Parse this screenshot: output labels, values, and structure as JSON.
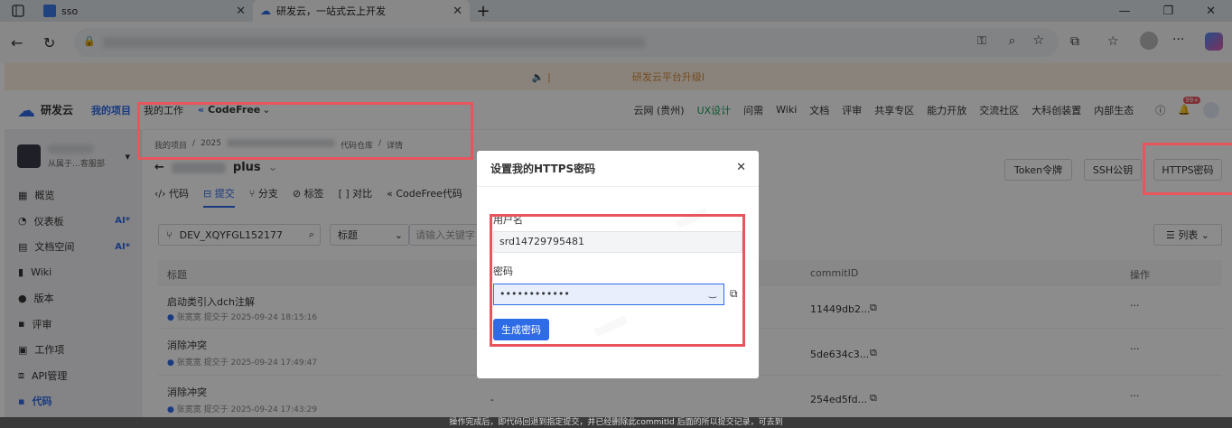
{
  "browser": {
    "tabs": [
      {
        "title": "sso"
      },
      {
        "title": "研发云，一站式云上开发"
      }
    ]
  },
  "banner": {
    "text": "研发云平台升级I"
  },
  "topnav": {
    "product": "研发云",
    "links": [
      "我的项目",
      "我的工作"
    ],
    "codefree": "CodeFree",
    "right": [
      "云网 (贵州)",
      "UX设计",
      "问需",
      "Wiki",
      "文档",
      "评审",
      "共享专区",
      "能力开放",
      "交流社区",
      "大科创装置",
      "内部生态"
    ],
    "badge": "99+"
  },
  "sidebar": {
    "org": "从属于…客服部",
    "items": [
      {
        "label": "概览",
        "ai": ""
      },
      {
        "label": "仪表板",
        "ai": "AI*"
      },
      {
        "label": "文档空间",
        "ai": "AI*"
      },
      {
        "label": "Wiki",
        "ai": ""
      },
      {
        "label": "版本",
        "ai": ""
      },
      {
        "label": "评审",
        "ai": ""
      },
      {
        "label": "工作项",
        "ai": ""
      },
      {
        "label": "API管理",
        "ai": ""
      },
      {
        "label": "代码",
        "ai": ""
      }
    ]
  },
  "main": {
    "breadcrumb": [
      "我的项目",
      "2025",
      "代码仓库",
      "详情"
    ],
    "repo_name": "plus",
    "tabs": [
      "代码",
      "提交",
      "分支",
      "标签",
      "对比",
      "CodeFree代码"
    ],
    "branch": "DEV_XQYFGL152177",
    "filter_select": "标题",
    "keyword_placeholder": "请输入关键字",
    "view_toggle": "列表",
    "buttons": {
      "token": "Token令牌",
      "ssh": "SSH公钥",
      "https": "HTTPS密码"
    },
    "columns": {
      "title": "标题",
      "commit": "commitID",
      "ops": "操作"
    },
    "rows": [
      {
        "title": "启动类引入dch注解",
        "author": "张宽宽",
        "meta": "提交于 2025-09-24 18:15:16",
        "commit": "11449db2...",
        "ops": "···"
      },
      {
        "title": "消除冲突",
        "author": "张宽宽",
        "meta": "提交于 2025-09-24 17:49:47",
        "commit": "5de634c3...",
        "ops": "···"
      },
      {
        "title": "消除冲突",
        "author": "张宽宽",
        "meta": "提交于 2025-09-24 17:43:29",
        "commit": "254ed5fd...",
        "ops": "···",
        "dash": "-"
      }
    ],
    "footer_note": "操作完成后，即代码回退到指定提交，并已经删除此commitId 后面的所以提交记录，可去到"
  },
  "modal": {
    "title": "设置我的HTTPS密码",
    "username_label": "用户名",
    "username_value": "srd14729795481",
    "password_label": "密码",
    "password_value": "••••••••••••",
    "generate_label": "生成密码"
  },
  "colors": {
    "accent": "#2e6be6",
    "highlight": "#e8555d",
    "banner_text": "#d58a3a"
  }
}
